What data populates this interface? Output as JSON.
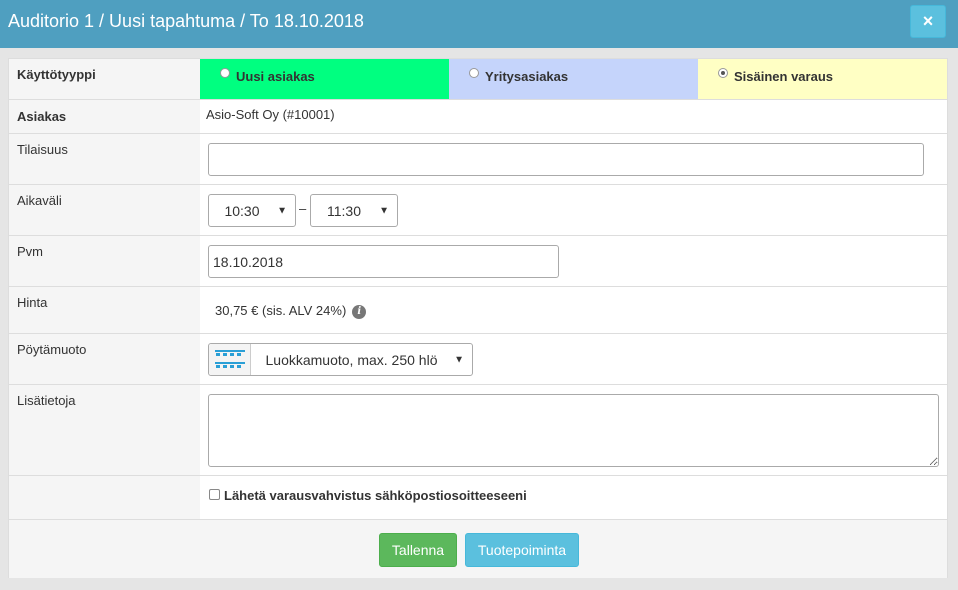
{
  "window": {
    "title": "Auditorio 1 / Uusi tapahtuma / To 18.10.2018",
    "close_symbol": "×"
  },
  "colors": {
    "header": "#4f9fc0",
    "uusi": "#00ff80",
    "yritys": "#c5d4fb",
    "sisainen": "#ffffc4",
    "save": "#5cb85c",
    "info": "#5bc0de"
  },
  "form": {
    "kayttotyyppi": {
      "label": "Käyttötyyppi",
      "options": [
        {
          "label": "Uusi asiakas",
          "checked": false
        },
        {
          "label": "Yritysasiakas",
          "checked": false
        },
        {
          "label": "Sisäinen varaus",
          "checked": true
        }
      ]
    },
    "asiakas": {
      "label": "Asiakas",
      "value": "Asio-Soft Oy (#10001)"
    },
    "tilaisuus": {
      "label": "Tilaisuus",
      "value": ""
    },
    "aikavali": {
      "label": "Aikaväli",
      "start": "10:30",
      "separator": "–",
      "end": "11:30"
    },
    "pvm": {
      "label": "Pvm",
      "value": "18.10.2018"
    },
    "hinta": {
      "label": "Hinta",
      "value": "30,75 € (sis. ALV 24%)"
    },
    "poytamuoto": {
      "label": "Pöytämuoto",
      "value": "Luokkamuoto, max. 250 hlö"
    },
    "lisatietoja": {
      "label": "Lisätietoja",
      "value": ""
    },
    "confirmation": {
      "label": "Lähetä varausvahvistus sähköpostiosoitteeseeni",
      "checked": false
    }
  },
  "buttons": {
    "save": "Tallenna",
    "products": "Tuotepoiminta"
  }
}
